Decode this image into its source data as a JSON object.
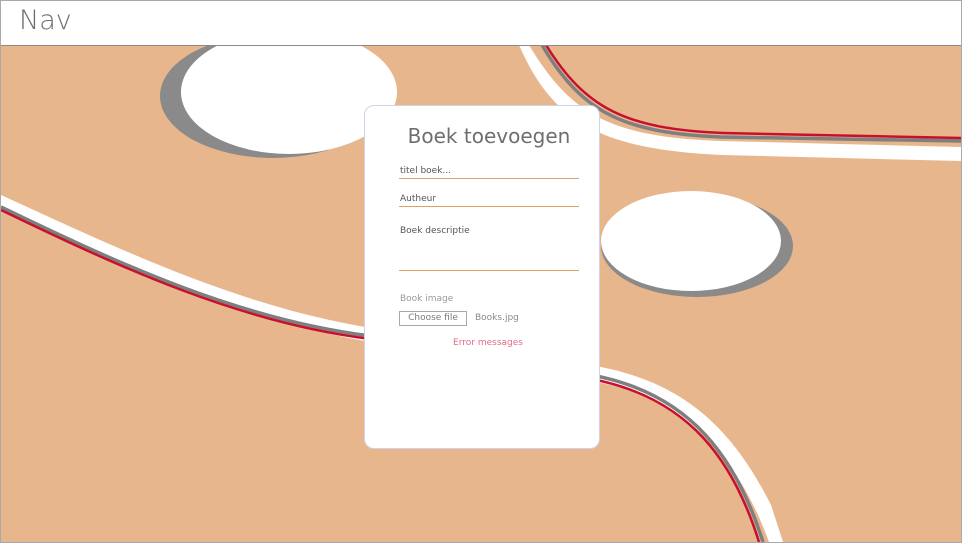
{
  "nav": {
    "title": "Nav"
  },
  "form": {
    "title": "Boek toevoegen",
    "title_placeholder": "titel boek...",
    "author_placeholder": "Autheur",
    "description_placeholder": "Boek descriptie",
    "image_label": "Book image",
    "file_button_label": "Choose file",
    "file_name": "Books.jpg",
    "error_text": "Error messages"
  },
  "colors": {
    "background": "#e8b68c",
    "input_underline": "#dba266",
    "error": "#e36b86",
    "accent_line": "#c8102e"
  }
}
